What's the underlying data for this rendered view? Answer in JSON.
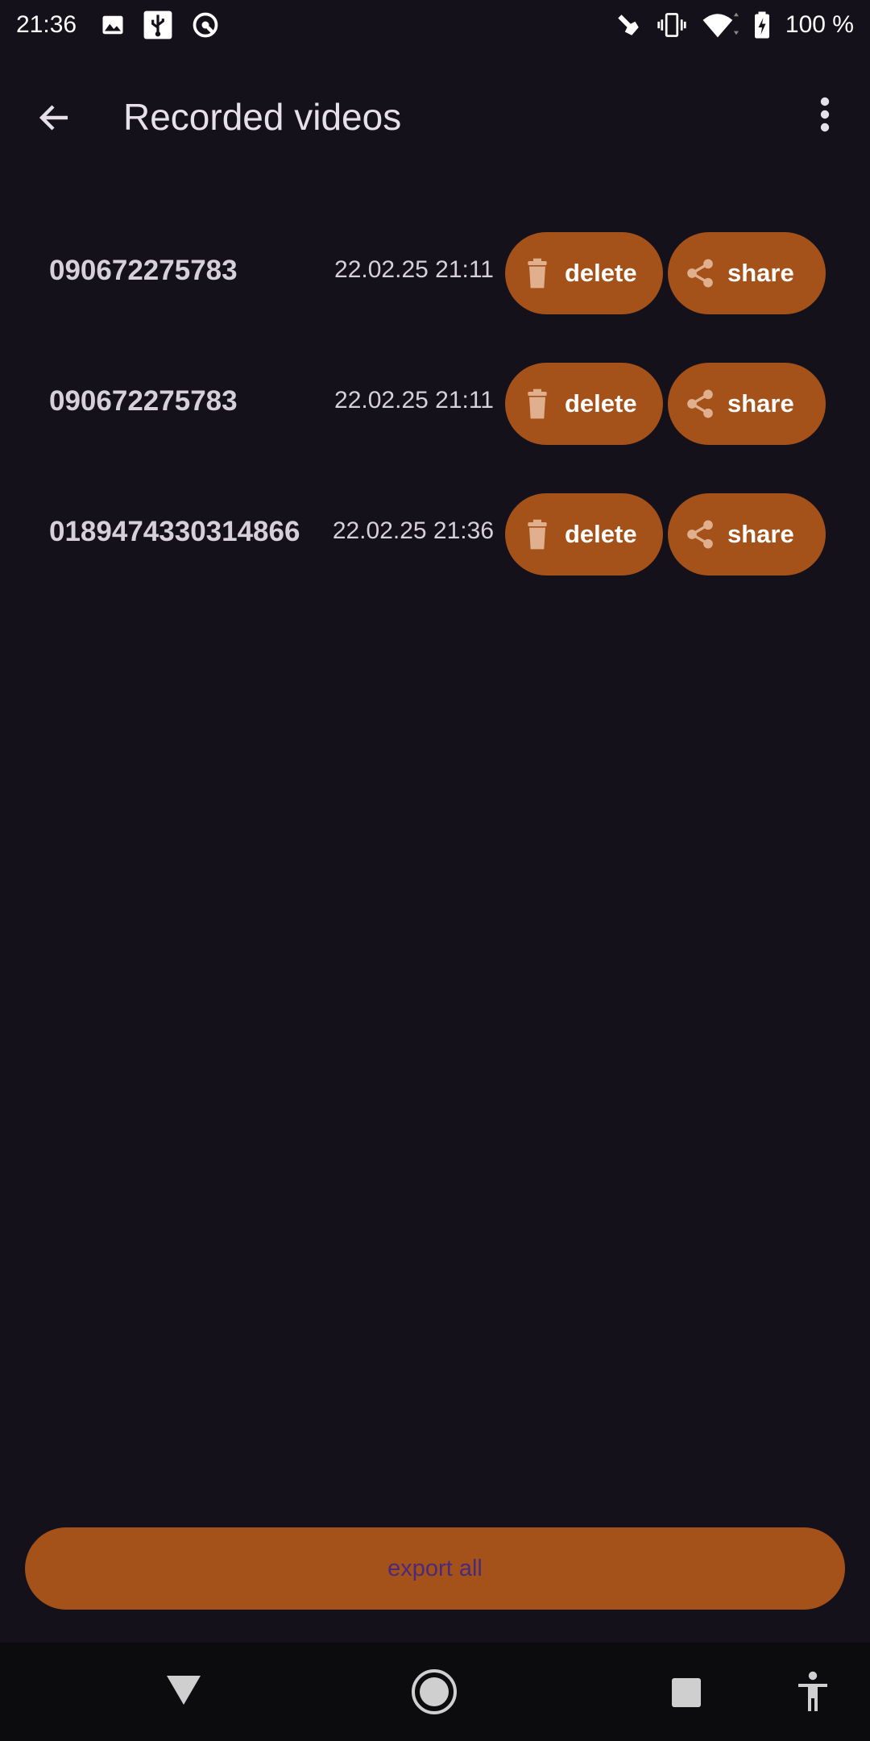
{
  "status_bar": {
    "time": "21:36",
    "battery": "100 %",
    "icons_left": [
      "image-icon",
      "usb-icon",
      "vpn-icon"
    ],
    "icons_right": [
      "touch-icon",
      "vibrate-icon",
      "wifi-icon",
      "battery-charging-icon"
    ]
  },
  "app_bar": {
    "title": "Recorded videos",
    "back_icon": "arrow-back-icon",
    "menu_icon": "more-vert-icon"
  },
  "recordings": [
    {
      "id": "090672275783",
      "date": "22.02.25 21:11",
      "delete_label": "delete",
      "share_label": "share"
    },
    {
      "id": "090672275783",
      "date": "22.02.25 21:11",
      "delete_label": "delete",
      "share_label": "share"
    },
    {
      "id": "0189474330314866",
      "date": "22.02.25 21:36",
      "delete_label": "delete",
      "share_label": "share"
    }
  ],
  "export": {
    "label": "export all"
  },
  "nav": {
    "icons": [
      "back-triangle-icon",
      "home-circle-icon",
      "recents-square-icon",
      "accessibility-icon"
    ]
  },
  "colors": {
    "background": "#14111a",
    "button": "#a4511a",
    "export_text": "#4b2a7a",
    "navbar": "#0c0b0e"
  }
}
